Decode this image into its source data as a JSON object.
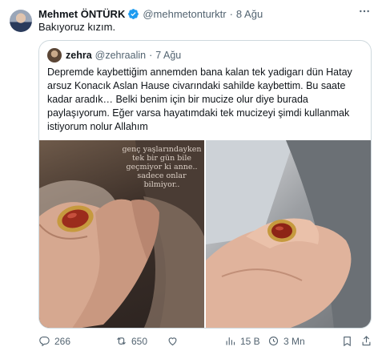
{
  "tweet": {
    "author_name": "Mehmet ÖNTÜRK",
    "author_handle": "@mehmetonturktr",
    "separator": "·",
    "time": "8 Ağu",
    "text": "Bakıyoruz kızım.",
    "more_icon": "more-horizontal-icon",
    "verified_color": "#1d9bf0"
  },
  "quote": {
    "author_name": "zehra",
    "author_handle": "@zehraalin",
    "separator": "·",
    "time": "7 Ağu",
    "text": "Depremde kaybettiğim annemden bana kalan tek yadigarı dün Hatay arsuz Konacık Aslan Hause civarındaki sahilde kaybettim. Bu saate kadar aradık… Belki benim için bir mucize olur diye burada paylaşıyorum. Eğer varsa hayatımdaki tek mucizeyi şimdi kullanmak istiyorum nolur Allahım",
    "image_left_caption": "genç yaşlarındayken tek bir gün bile geçmiyor ki anne.. sadece onlar bilmiyor.."
  },
  "actions": {
    "replies": "266",
    "retweets": "650",
    "likes": "",
    "views": "15 B",
    "bookmarks": "3 Mn",
    "reply_icon": "reply-icon",
    "retweet_icon": "retweet-icon",
    "like_icon": "heart-icon",
    "views_icon": "views-icon",
    "bookmark_icon": "bookmark-icon",
    "share_icon": "share-icon"
  }
}
